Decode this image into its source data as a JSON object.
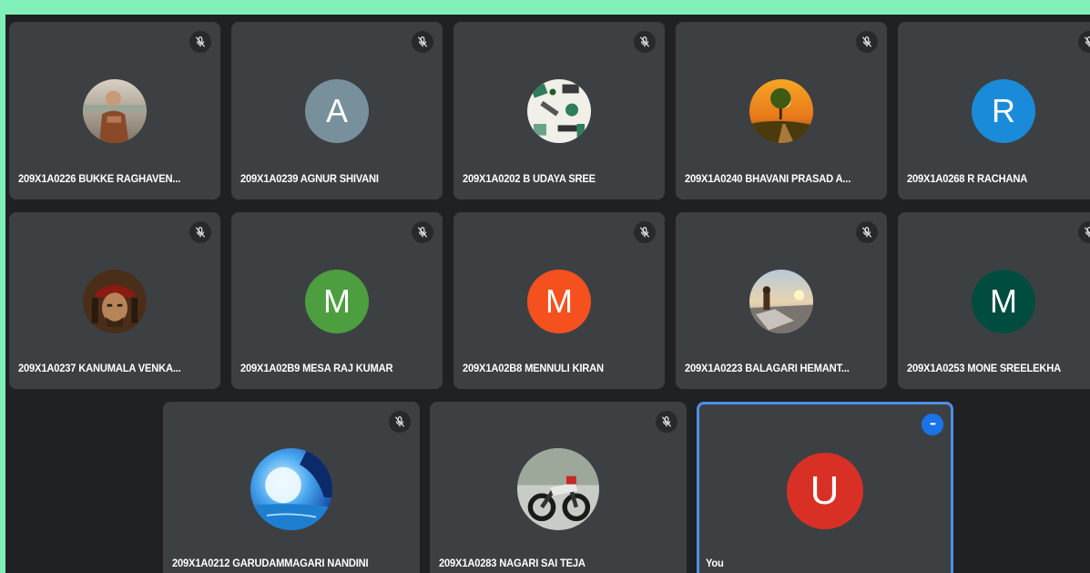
{
  "participants": [
    {
      "name": "209X1A0226 BUKKE RAGHAVEN...",
      "avatar_type": "photo",
      "photo_theme": "person-portrait"
    },
    {
      "name": "209X1A0239 AGNUR SHIVANI",
      "avatar_type": "letter",
      "letter": "A",
      "color": "#78909c"
    },
    {
      "name": "209X1A0202 B UDAYA SREE",
      "avatar_type": "photo",
      "photo_theme": "desk-items"
    },
    {
      "name": "209X1A0240 BHAVANI PRASAD A...",
      "avatar_type": "photo",
      "photo_theme": "sunset-tree"
    },
    {
      "name": "209X1A0268 R RACHANA",
      "avatar_type": "letter",
      "letter": "R",
      "color": "#1a8bd8"
    },
    {
      "name": "209X1A0237 KANUMALA VENKA...",
      "avatar_type": "photo",
      "photo_theme": "pirate-portrait"
    },
    {
      "name": "209X1A02B9 MESA RAJ KUMAR",
      "avatar_type": "letter",
      "letter": "M",
      "color": "#4c9e3f"
    },
    {
      "name": "209X1A02B8 MENNULI KIRAN",
      "avatar_type": "letter",
      "letter": "M",
      "color": "#f4511e"
    },
    {
      "name": "209X1A0223 BALAGARI HEMANT...",
      "avatar_type": "photo",
      "photo_theme": "beach-sunset"
    },
    {
      "name": "209X1A0253 MONE SREELEKHA",
      "avatar_type": "letter",
      "letter": "M",
      "color": "#004d40"
    },
    {
      "name": "209X1A0212 GARUDAMMAGARI NANDINI",
      "avatar_type": "photo",
      "photo_theme": "moon-night"
    },
    {
      "name": "209X1A0283 NAGARI SAI TEJA",
      "avatar_type": "photo",
      "photo_theme": "motorcycle"
    }
  ],
  "self_tile": {
    "name": "You",
    "letter": "U",
    "color": "#d93025",
    "more_icon": "more-options-icon"
  },
  "icons": {
    "mic": "mic-off-icon"
  },
  "colors": {
    "background": "#202124",
    "tile": "#3c4043",
    "self_border": "#4f8fe6",
    "accent": "#1a73e8"
  }
}
